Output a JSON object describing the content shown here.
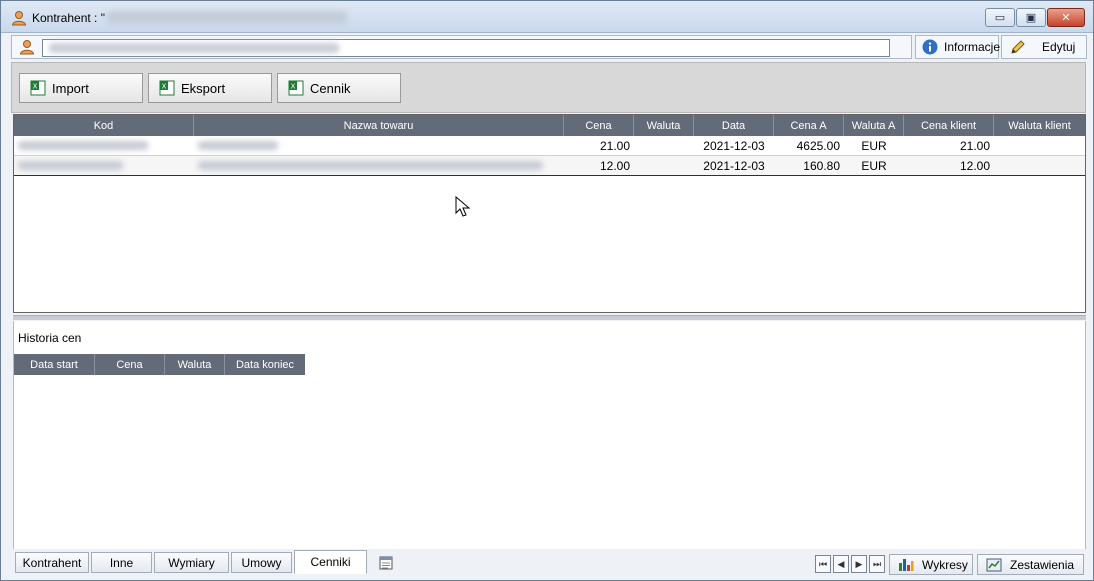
{
  "window": {
    "title": "Kontrahent : \"",
    "controls": {
      "minimize": "▭",
      "maximize": "▣",
      "close": "✕"
    }
  },
  "header": {
    "informacje_label": "Informacje",
    "edytuj_label": "Edytuj"
  },
  "toolbar": {
    "import_label": "Import",
    "eksport_label": "Eksport",
    "cennik_label": "Cennik"
  },
  "grid": {
    "columns": [
      "Kod",
      "Nazwa towaru",
      "Cena",
      "Waluta",
      "Data",
      "Cena A",
      "Waluta A",
      "Cena klient",
      "Waluta klient"
    ],
    "rows": [
      {
        "cena": "21.00",
        "waluta": "",
        "data": "2021-12-03",
        "cena_a": "4625.00",
        "waluta_a": "EUR",
        "cena_klient": "21.00",
        "waluta_klient": ""
      },
      {
        "cena": "12.00",
        "waluta": "",
        "data": "2021-12-03",
        "cena_a": "160.80",
        "waluta_a": "EUR",
        "cena_klient": "12.00",
        "waluta_klient": ""
      }
    ]
  },
  "history": {
    "label": "Historia cen",
    "columns": [
      "Data start",
      "Cena",
      "Waluta",
      "Data koniec"
    ]
  },
  "tabs": [
    "Kontrahent",
    "Inne",
    "Wymiary",
    "Umowy",
    "Cenniki"
  ],
  "active_tab": "Cenniki",
  "bottom": {
    "nav": {
      "first": "⏮",
      "prev": "◀",
      "next": "▶",
      "last": "⏭"
    },
    "wykresy_label": "Wykresy",
    "zestawienia_label": "Zestawienia"
  },
  "colors": {
    "grid_header": "#646b78",
    "title_bar": "#c9d8ec",
    "close_button": "#c5432b",
    "toolbar_bg": "#d8d8d8",
    "excel_icon": "#1e7b35"
  },
  "icons": {
    "title": "contact-person-icon",
    "name": "contact-person-icon",
    "informacje": "info-icon",
    "edytuj": "pencil-icon",
    "import": "excel-icon",
    "eksport": "excel-icon",
    "cennik": "excel-icon",
    "tabs_extra": "notepad-icon",
    "wykresy": "bar-chart-icon",
    "zestawienia": "report-icon"
  }
}
